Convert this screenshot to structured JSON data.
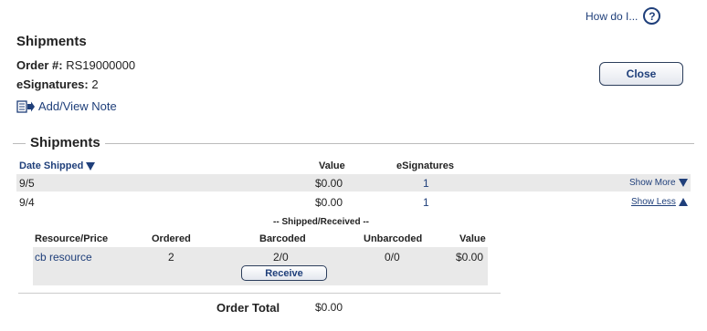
{
  "help": {
    "label": "How do I...",
    "icon": "help-icon"
  },
  "header": {
    "title": "Shipments",
    "order_label": "Order #:",
    "order_value": "RS19000000",
    "esig_label": "eSignatures:",
    "esig_value": "2",
    "note_link": "Add/View Note",
    "note_icon": "note-arrow-icon",
    "close_button": "Close"
  },
  "shipments": {
    "legend": "Shipments",
    "columns": {
      "date": "Date Shipped",
      "value": "Value",
      "esignatures": "eSignatures"
    },
    "rows": [
      {
        "date": "9/5",
        "value": "$0.00",
        "esignatures": "1",
        "toggle": "Show More"
      },
      {
        "date": "9/4",
        "value": "$0.00",
        "esignatures": "1",
        "toggle": "Show Less"
      }
    ]
  },
  "detail": {
    "group_header": "-- Shipped/Received --",
    "columns": {
      "resource": "Resource/Price",
      "ordered": "Ordered",
      "barcoded": "Barcoded",
      "unbarcoded": "Unbarcoded",
      "value": "Value"
    },
    "rows": [
      {
        "resource": "cb resource",
        "ordered": "2",
        "barcoded": "2/0",
        "unbarcoded": "0/0",
        "value": "$0.00"
      }
    ],
    "receive_button": "Receive"
  },
  "totals": {
    "label": "Order Total",
    "value": "$0.00"
  },
  "colors": {
    "link": "#1f3f7a",
    "row_shade": "#e9e9e9"
  }
}
